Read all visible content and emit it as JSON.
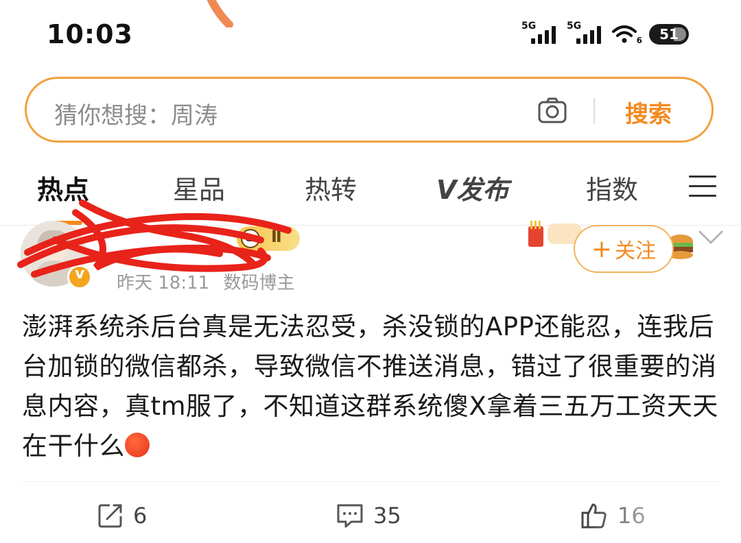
{
  "status_bar": {
    "time": "10:03",
    "signal_1_label": "5G",
    "signal_2_label": "5G",
    "wifi_suffix": "6",
    "battery_level": "51"
  },
  "search": {
    "placeholder": "猜你想搜：周涛",
    "button_label": "搜索",
    "accent_color": "#f48a1e"
  },
  "tabs": [
    {
      "label": "热点",
      "active": true
    },
    {
      "label": "星品",
      "active": false
    },
    {
      "label": "热转",
      "active": false
    },
    {
      "label": "V发布",
      "active": false
    },
    {
      "label": "指数",
      "active": false
    }
  ],
  "post": {
    "time": "昨天 18:11",
    "author_tag": "数码博主",
    "follow_label": "关注",
    "follow_prefix": "+",
    "body": "澎湃系统杀后台真是无法忍受，杀没锁的APP还能忍，连我后台加锁的微信都杀，导致微信不推送消息，错过了很重要的消息内容，真tm服了，不知道这群系统傻X拿着三五万工资天天在干什么",
    "level_badge": "Ⅱ"
  },
  "actions": {
    "repost_count": "6",
    "comment_count": "35",
    "like_count": "16"
  }
}
